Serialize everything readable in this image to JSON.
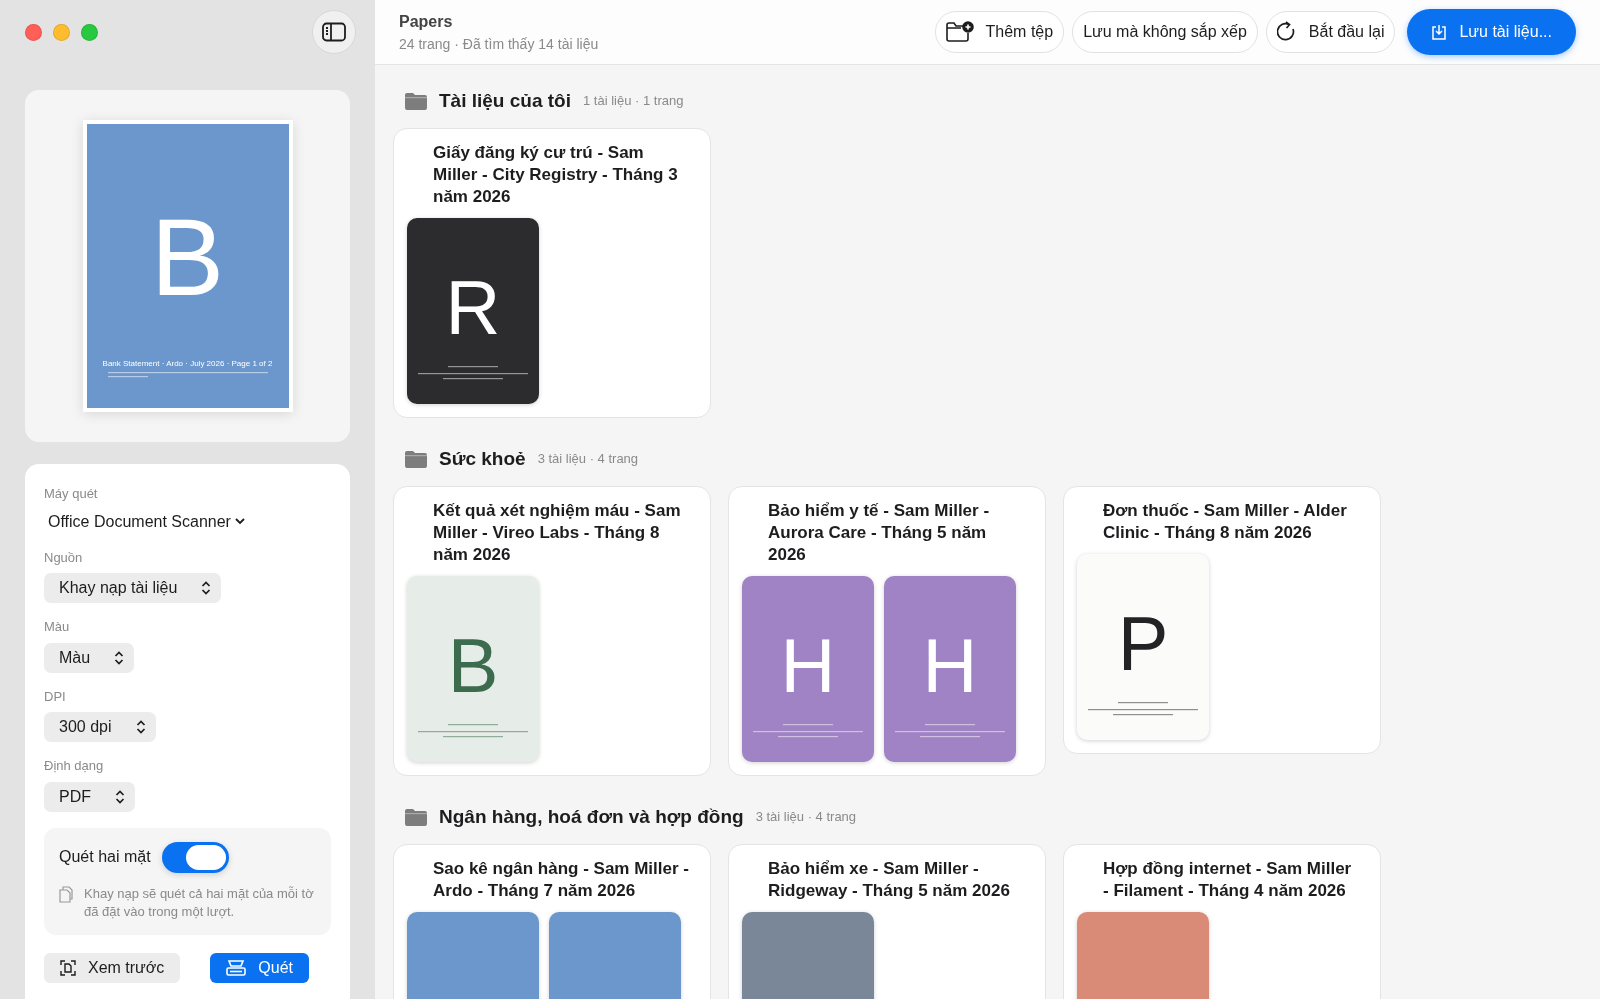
{
  "window": {
    "title": "Papers",
    "subtitle": "24 trang · Đã tìm thấy 14 tài liệu"
  },
  "toolbar": {
    "buttons": [
      {
        "label": "Thêm tệp",
        "kind": "add-folder"
      },
      {
        "label": "Lưu mà không sắp xếp",
        "kind": "plain"
      },
      {
        "label": "Bắt đầu lại",
        "kind": "restart"
      },
      {
        "label": "Lưu tài liệu...",
        "kind": "primary"
      }
    ]
  },
  "preview": {
    "color": "#6b97cc",
    "letter": {
      "text": "B",
      "color": "#ffffff"
    },
    "caption": "Bank Statement · Ardo · July 2026 · Page 1 of 2"
  },
  "settings": {
    "scanner": {
      "label": "Máy quét",
      "value": "Office Document Scanner"
    },
    "fields": [
      {
        "label": "Nguồn",
        "value": "Khay nạp tài liệu"
      },
      {
        "label": "Màu",
        "value": "Màu"
      },
      {
        "label": "DPI",
        "value": "300 dpi"
      },
      {
        "label": "Định dạng",
        "value": "PDF"
      }
    ],
    "duplex": {
      "label": "Quét hai mặt",
      "on": true,
      "hint": "Khay nạp sẽ quét cả hai mặt của mỗi tờ đã đặt vào trong một lượt."
    },
    "buttons": [
      {
        "label": "Xem trước",
        "kind": "preview"
      },
      {
        "label": "Quét",
        "kind": "scan"
      }
    ]
  },
  "groups": [
    {
      "title": "Tài liệu của tôi",
      "meta": "1 tài liệu · 1 trang",
      "documents": [
        {
          "title": "Giấy đăng ký cư trú - Sam Miller - City Registry - Tháng 3 năm 2026",
          "pages": [
            {
              "color": "#2c2c2e",
              "letter": {
                "text": "R",
                "color": "#ffffff"
              }
            }
          ]
        }
      ]
    },
    {
      "title": "Sức khoẻ",
      "meta": "3 tài liệu · 4 trang",
      "documents": [
        {
          "title": "Kết quả xét nghiệm máu - Sam Miller - Vireo Labs - Tháng 8 năm 2026",
          "pages": [
            {
              "color": "#e6ece7",
              "letter": {
                "text": "B",
                "color": "#3d6b4e"
              }
            }
          ]
        },
        {
          "title": "Bảo hiểm y tế - Sam Miller - Aurora Care - Tháng 5 năm 2026",
          "pages": [
            {
              "color": "#a083c4",
              "letter": {
                "text": "H",
                "color": "#ffffff"
              }
            },
            {
              "color": "#a083c4",
              "letter": {
                "text": "H",
                "color": "#ffffff"
              }
            }
          ]
        },
        {
          "title": "Đơn thuốc - Sam Miller - Alder Clinic - Tháng 8 năm 2026",
          "pages": [
            {
              "color": "#fbfbfa",
              "letter": {
                "text": "P",
                "color": "#232326"
              }
            }
          ]
        }
      ]
    },
    {
      "title": "Ngân hàng, hoá đơn và hợp đồng",
      "meta": "3 tài liệu · 4 trang",
      "documents": [
        {
          "title": "Sao kê ngân hàng - Sam Miller - Ardo - Tháng 7 năm 2026",
          "pages": [
            {
              "color": "#6b97cc"
            },
            {
              "color": "#6b97cc"
            }
          ]
        },
        {
          "title": "Bảo hiểm xe - Sam Miller - Ridgeway - Tháng 5 năm 2026",
          "pages": [
            {
              "color": "#7a8798"
            }
          ]
        },
        {
          "title": "Hợp đồng internet - Sam Miller - Filament - Tháng 4 năm 2026",
          "pages": [
            {
              "color": "#d98b78"
            }
          ]
        }
      ]
    }
  ]
}
